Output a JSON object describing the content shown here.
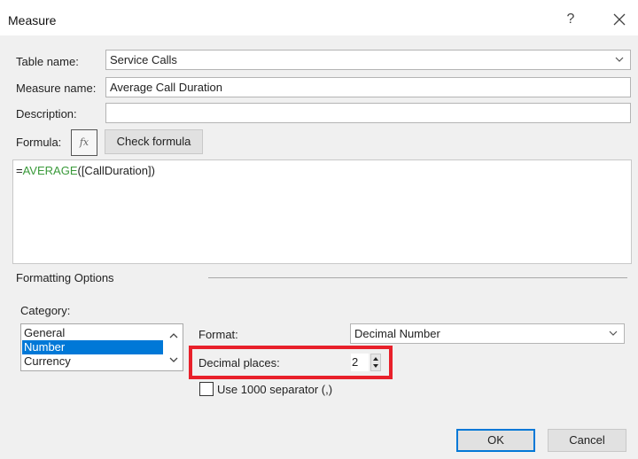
{
  "dialog": {
    "title": "Measure",
    "help_label": "?",
    "close_icon": "close-icon"
  },
  "form": {
    "table_name_label": "Table name:",
    "table_name_value": "Service Calls",
    "measure_name_label": "Measure name:",
    "measure_name_value": "Average Call Duration",
    "description_label": "Description:",
    "description_value": "",
    "formula_label": "Formula:",
    "fx_label": "fx",
    "check_formula_label": "Check formula",
    "formula_prefix": "=",
    "formula_function": "AVERAGE",
    "formula_args": "([CallDuration])"
  },
  "formatting": {
    "section_label": "Formatting Options",
    "category_label": "Category:",
    "categories": [
      {
        "label": "General",
        "selected": false
      },
      {
        "label": "Number",
        "selected": true
      },
      {
        "label": "Currency",
        "selected": false
      }
    ],
    "format_label": "Format:",
    "format_value": "Decimal Number",
    "decimal_places_label": "Decimal places:",
    "decimal_places_value": "2",
    "separator_label": "Use 1000 separator (,)",
    "separator_checked": false
  },
  "buttons": {
    "ok_label": "OK",
    "cancel_label": "Cancel"
  },
  "colors": {
    "accent": "#0078d7",
    "highlight": "#e8202a",
    "function_green": "#3a9a3a"
  }
}
